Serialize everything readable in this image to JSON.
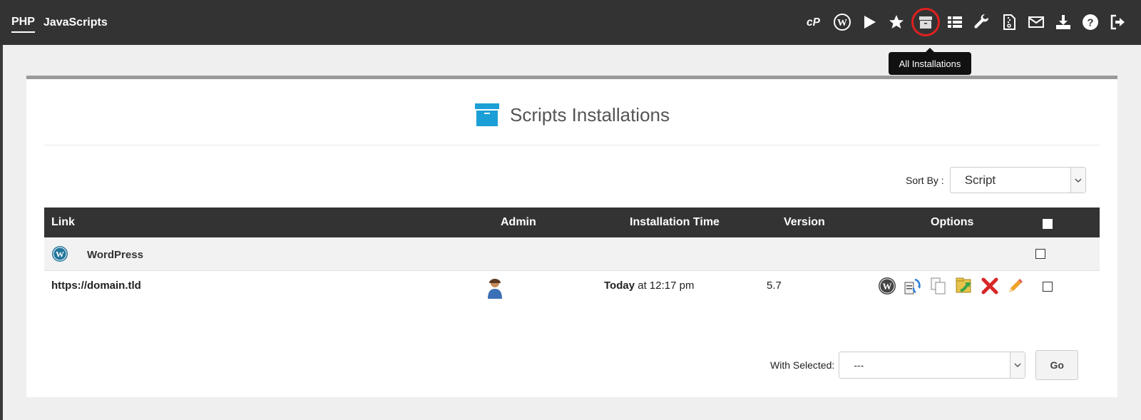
{
  "nav": {
    "tabs": [
      {
        "label": "PHP",
        "active": true
      },
      {
        "label": "JavaScripts",
        "active": false
      }
    ],
    "toolbar_icons": [
      "cpanel-icon",
      "wordpress-icon",
      "play-icon",
      "star-icon",
      "archive-icon",
      "list-icon",
      "wrench-icon",
      "zip-file-icon",
      "mail-icon",
      "download-icon",
      "help-icon",
      "logout-icon"
    ],
    "tooltip": "All Installations"
  },
  "page": {
    "title": "Scripts Installations",
    "sort_label": "Sort By :",
    "sort_value": "Script"
  },
  "table": {
    "headers": {
      "link": "Link",
      "admin": "Admin",
      "time": "Installation Time",
      "version": "Version",
      "options": "Options"
    },
    "group_name": "WordPress",
    "rows": [
      {
        "link": "https://domain.tld",
        "time_bold": "Today",
        "time_rest": " at 12:17 pm",
        "version": "5.7"
      }
    ]
  },
  "footer": {
    "with_selected_label": "With Selected:",
    "with_selected_value": "---",
    "go_label": "Go"
  },
  "colors": {
    "topbar": "#333333",
    "accent_blue": "#1a9fd6",
    "highlight_red": "#e02020"
  }
}
